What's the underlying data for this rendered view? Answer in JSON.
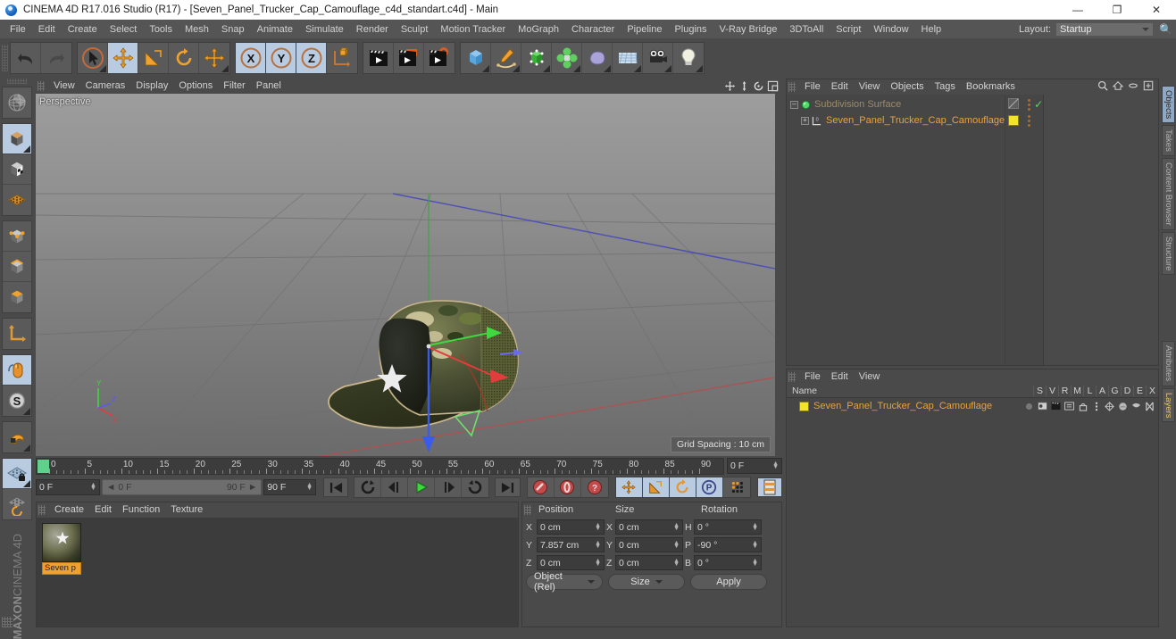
{
  "window": {
    "app_icon": "c4d-logo-icon",
    "title": "CINEMA 4D R17.016 Studio (R17) - [Seven_Panel_Trucker_Cap_Camouflage_c4d_standart.c4d] - Main",
    "minimize": "—",
    "maximize": "❐",
    "close": "✕"
  },
  "menubar": {
    "items": [
      "File",
      "Edit",
      "Create",
      "Select",
      "Tools",
      "Mesh",
      "Snap",
      "Animate",
      "Simulate",
      "Render",
      "Sculpt",
      "Motion Tracker",
      "MoGraph",
      "Character",
      "Pipeline",
      "Plugins",
      "V-Ray Bridge",
      "3DToAll",
      "Script",
      "Window",
      "Help"
    ],
    "layout_label": "Layout:",
    "layout_value": "Startup",
    "search_icon": "search-icon"
  },
  "toolbar": {
    "groups": [
      {
        "name": "history",
        "buttons": [
          {
            "icon": "undo-icon",
            "selected": false,
            "disabled": false
          },
          {
            "icon": "redo-icon",
            "selected": false,
            "disabled": true
          }
        ]
      },
      {
        "name": "transform-tools",
        "buttons": [
          {
            "icon": "select-live-icon",
            "selected": false,
            "disabled": false
          },
          {
            "icon": "move-icon",
            "selected": true,
            "disabled": false
          },
          {
            "icon": "scale-icon",
            "selected": false,
            "disabled": false
          },
          {
            "icon": "rotate-icon",
            "selected": false,
            "disabled": false
          },
          {
            "icon": "move-alt-icon",
            "selected": false,
            "disabled": false
          }
        ]
      },
      {
        "name": "axis-locks",
        "buttons": [
          {
            "icon": "x-axis-icon",
            "selected": true,
            "disabled": false
          },
          {
            "icon": "y-axis-icon",
            "selected": true,
            "disabled": false
          },
          {
            "icon": "z-axis-icon",
            "selected": true,
            "disabled": false
          },
          {
            "icon": "world-coordinate-icon",
            "selected": false,
            "disabled": false
          }
        ]
      },
      {
        "name": "render",
        "buttons": [
          {
            "icon": "render-view-icon",
            "selected": false,
            "disabled": false
          },
          {
            "icon": "render-picture-viewer-icon",
            "selected": false,
            "disabled": false
          },
          {
            "icon": "render-settings-icon",
            "selected": false,
            "disabled": false
          }
        ]
      },
      {
        "name": "create",
        "buttons": [
          {
            "icon": "cube-primitive-icon",
            "selected": false,
            "disabled": false
          },
          {
            "icon": "spline-pen-icon",
            "selected": false,
            "disabled": false
          },
          {
            "icon": "nurbs-generator-icon",
            "selected": false,
            "disabled": false
          },
          {
            "icon": "array-modeling-icon",
            "selected": false,
            "disabled": false
          },
          {
            "icon": "deformer-icon",
            "selected": false,
            "disabled": false
          },
          {
            "icon": "scene-environment-icon",
            "selected": false,
            "disabled": false
          },
          {
            "icon": "camera-icon",
            "selected": false,
            "disabled": false
          },
          {
            "icon": "light-icon",
            "selected": false,
            "disabled": false
          }
        ]
      }
    ]
  },
  "left_toolbar": {
    "groups": [
      {
        "buttons": [
          {
            "icon": "make-editable-icon"
          }
        ]
      },
      {
        "buttons": [
          {
            "icon": "model-mode-icon",
            "selected": true
          },
          {
            "icon": "texture-mode-icon",
            "selected": false
          },
          {
            "icon": "points-mode-icon",
            "selected": false
          }
        ]
      },
      {
        "buttons": [
          {
            "icon": "points-tool-icon",
            "selected": false
          },
          {
            "icon": "edges-tool-icon",
            "selected": false
          },
          {
            "icon": "polygons-tool-icon",
            "selected": false
          }
        ]
      },
      {
        "buttons": [
          {
            "icon": "axis-modify-icon",
            "selected": false
          }
        ]
      },
      {
        "buttons": [
          {
            "icon": "viewport-solo-icon",
            "selected": true
          },
          {
            "icon": "enable-snap-icon",
            "selected": true
          }
        ]
      },
      {
        "buttons": [
          {
            "icon": "magnet-icon",
            "selected": false
          }
        ]
      },
      {
        "buttons": [
          {
            "icon": "workplane-lock-icon",
            "selected": true
          },
          {
            "icon": "workplane-rotate-icon",
            "selected": false
          }
        ]
      }
    ],
    "brand_bold": "MAXON",
    "brand_light": "CINEMA 4D"
  },
  "viewport": {
    "menu": [
      "View",
      "Cameras",
      "Display",
      "Options",
      "Filter",
      "Panel"
    ],
    "corner_icons": [
      "pan-view-icon",
      "dolly-view-icon",
      "rotate-view-icon",
      "maximize-view-icon"
    ],
    "label": "Perspective",
    "grid_spacing": "Grid Spacing : 10 cm",
    "axis_gizmo": {
      "x": "X",
      "y": "Y",
      "z": "Z"
    },
    "model_description": "Seven panel trucker cap, camouflage crown with white star, dark green brim"
  },
  "timeline": {
    "ruler_labels": [
      "0",
      "5",
      "10",
      "15",
      "20",
      "25",
      "30",
      "35",
      "40",
      "45",
      "50",
      "55",
      "60",
      "65",
      "70",
      "75",
      "80",
      "85",
      "90"
    ],
    "start_frame": "0 F",
    "range_start": "0 F",
    "range_end": "90 F",
    "end_frame": "90 F",
    "current_frame": "0 F",
    "buttons": [
      {
        "icon": "go-to-start-icon",
        "selected": false
      },
      {
        "icon": "play-reverse-loop-icon",
        "selected": false
      },
      {
        "icon": "step-back-icon",
        "selected": false
      },
      {
        "icon": "play-icon",
        "selected": false
      },
      {
        "icon": "step-forward-icon",
        "selected": false
      },
      {
        "icon": "loop-icon",
        "selected": false
      },
      {
        "icon": "go-to-end-icon",
        "selected": false
      },
      {
        "icon": "record-keyframe-icon",
        "selected": false
      },
      {
        "icon": "autokey-icon",
        "selected": false
      },
      {
        "icon": "keyframe-selection-icon",
        "selected": false
      },
      {
        "icon": "position-key-icon",
        "selected": true
      },
      {
        "icon": "scale-key-icon",
        "selected": true
      },
      {
        "icon": "rotation-key-icon",
        "selected": true
      },
      {
        "icon": "pla-key-icon",
        "selected": true
      },
      {
        "icon": "point-level-animation-icon",
        "selected": false
      },
      {
        "icon": "timeline-layout-icon",
        "selected": true
      }
    ]
  },
  "material_manager": {
    "menu": [
      "Create",
      "Edit",
      "Function",
      "Texture"
    ],
    "materials": [
      {
        "name": "Seven p",
        "thumbnail": "camouflage-star-material"
      }
    ]
  },
  "coordinates": {
    "headers": [
      "Position",
      "Size",
      "Rotation"
    ],
    "rows": [
      {
        "pos_axis": "X",
        "pos_value": "0 cm",
        "size_axis": "X",
        "size_value": "0 cm",
        "rot_axis": "H",
        "rot_value": "0 °"
      },
      {
        "pos_axis": "Y",
        "pos_value": "7.857 cm",
        "size_axis": "Y",
        "size_value": "0 cm",
        "rot_axis": "P",
        "rot_value": "-90 °"
      },
      {
        "pos_axis": "Z",
        "pos_value": "0 cm",
        "size_axis": "Z",
        "size_value": "0 cm",
        "rot_axis": "B",
        "rot_value": "0 °"
      }
    ],
    "mode_dropdown": "Object (Rel)",
    "size_dropdown": "Size",
    "apply_button": "Apply"
  },
  "object_manager": {
    "menu": [
      "File",
      "Edit",
      "View",
      "Objects",
      "Tags",
      "Bookmarks"
    ],
    "header_icons": [
      "search-icon",
      "home-icon",
      "minimize-tree-icon",
      "expand-tree-icon"
    ],
    "items": [
      {
        "name": "Subdivision Surface",
        "level": 0,
        "icon": "subdivision-surface-icon",
        "dim": true,
        "tag_checkbox": "render-toggle",
        "tag_check": "✓"
      },
      {
        "name": "Seven_Panel_Trucker_Cap_Camouflage",
        "level": 1,
        "icon": "polygon-object-icon",
        "dim": false,
        "tag_swatch": "#f2e32b"
      }
    ]
  },
  "attribute_panel": {
    "menu": [
      "File",
      "Edit",
      "View"
    ],
    "columns": [
      "Name",
      "S",
      "V",
      "R",
      "M",
      "L",
      "A",
      "G",
      "D",
      "E",
      "X"
    ],
    "rows": [
      {
        "name": "Seven_Panel_Trucker_Cap_Camouflage",
        "swatch": "#f2e32b",
        "icons": [
          "solo-dot-icon",
          "view-icon",
          "render-icon",
          "manager-icon",
          "lock-icon",
          "animation-icon",
          "generator-icon",
          "deformer-icon",
          "expression-icon",
          "xref-icon"
        ]
      }
    ]
  },
  "right_tabs": {
    "top": [
      {
        "label": "Objects",
        "active": true
      },
      {
        "label": "Takes",
        "active": false
      },
      {
        "label": "Content Browser",
        "active": false
      },
      {
        "label": "Structure",
        "active": false
      }
    ],
    "bottom": [
      {
        "label": "Attributes",
        "active": false
      },
      {
        "label": "Layers",
        "active": false,
        "gold": true
      }
    ]
  },
  "colors": {
    "panel_bg": "#4a4a4a",
    "dark_bg": "#3c3c3c",
    "accent_orange": "#e8a33d",
    "selected_blue": "#b9cbe0",
    "material_label": "#f0a030",
    "swatch_yellow": "#f2e32b",
    "titlebar_bg": "#ffffff"
  }
}
